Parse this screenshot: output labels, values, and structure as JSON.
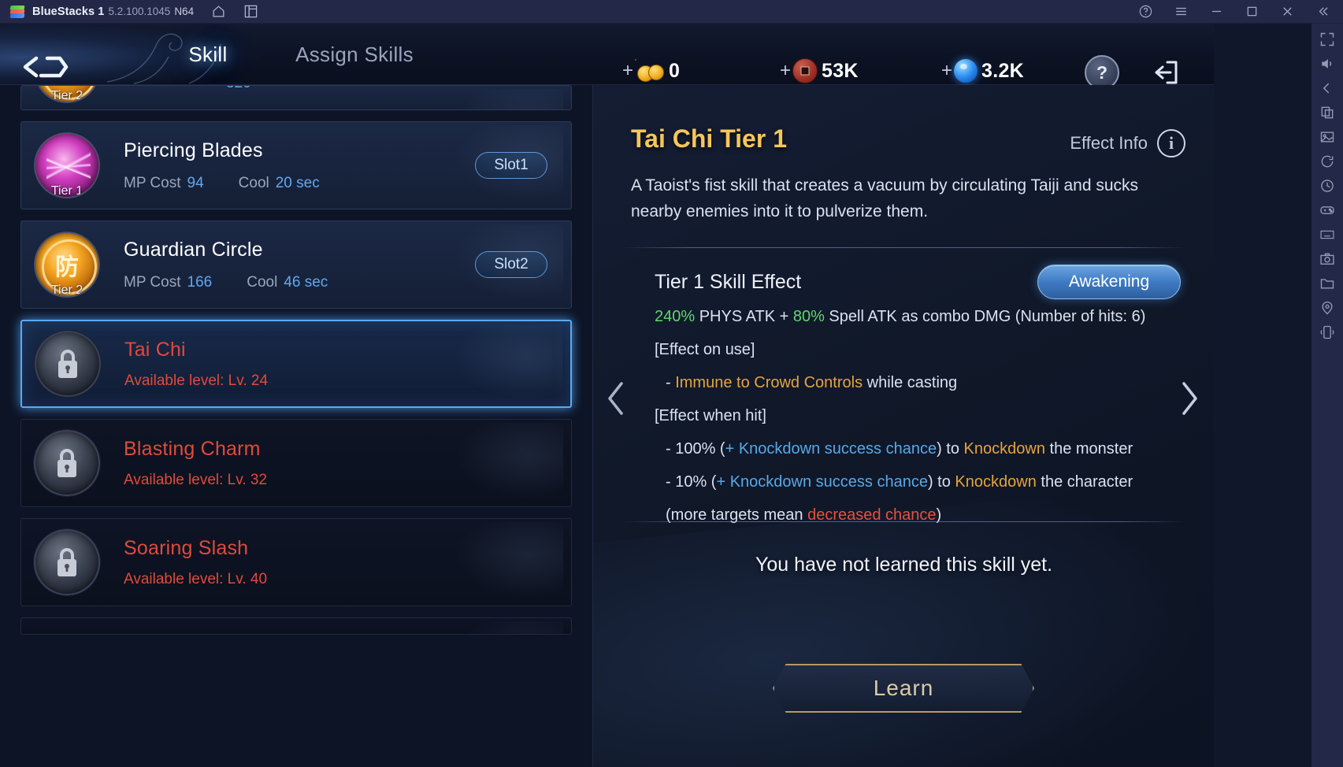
{
  "titlebar": {
    "app_name": "BlueStacks 1",
    "version": "5.2.100.1045",
    "arch": "N64",
    "icons": [
      "home-icon",
      "multi-instance-icon"
    ],
    "right_icons": [
      "help-icon",
      "menu-icon",
      "minimize-icon",
      "maximize-icon",
      "close-icon",
      "collapse-icon"
    ]
  },
  "rail": {
    "icons": [
      "fullscreen-icon",
      "volume-icon",
      "back-icon",
      "copy-icon",
      "gallery-icon",
      "rotate-icon",
      "clock-icon",
      "game-controls-icon",
      "keyboard-icon",
      "screenshot-icon",
      "folder-icon",
      "location-icon",
      "shake-icon"
    ]
  },
  "game_topbar": {
    "back_icon": "back-arrow-icon",
    "tabs": [
      {
        "label": "Skill",
        "active": true
      },
      {
        "label": "Assign Skills",
        "active": false
      }
    ],
    "currencies": [
      {
        "icon": "gold-coin-icon",
        "value": "0",
        "plus": "+"
      },
      {
        "icon": "copper-coin-icon",
        "value": "53K",
        "plus": "+"
      },
      {
        "icon": "blue-gem-icon",
        "value": "3.2K",
        "plus": "+"
      }
    ],
    "help_label": "?",
    "exit_icon": "exit-door-icon"
  },
  "skill_list": [
    {
      "partial": true,
      "name": "",
      "tier": "Tier 2",
      "state": "cut-off-top"
    },
    {
      "name": "Piercing Blades",
      "tier": "Tier 1",
      "mp_label": "MP Cost",
      "mp_value": "94",
      "cool_label": "Cool",
      "cool_value": "20 sec",
      "slot": "Slot1",
      "icon": "piercing-blades-icon",
      "locked": false,
      "selected": false
    },
    {
      "name": "Guardian Circle",
      "tier": "Tier 2",
      "mp_label": "MP Cost",
      "mp_value": "166",
      "cool_label": "Cool",
      "cool_value": "46 sec",
      "slot": "Slot2",
      "icon": "guardian-circle-icon",
      "cjk": "防",
      "locked": false,
      "selected": false
    },
    {
      "name": "Tai Chi",
      "lock_text": "Available level: Lv. 24",
      "icon": "padlock-icon",
      "locked": true,
      "selected": true
    },
    {
      "name": "Blasting Charm",
      "lock_text": "Available level: Lv. 32",
      "icon": "padlock-icon",
      "locked": true,
      "selected": false
    },
    {
      "name": "Soaring Slash",
      "lock_text": "Available level: Lv. 40",
      "icon": "padlock-icon",
      "locked": true,
      "selected": false
    }
  ],
  "detail": {
    "title": "Tai Chi Tier 1",
    "effect_info_label": "Effect Info",
    "info_icon": "info-icon",
    "description": "A Taoist's fist skill that creates a vacuum by circulating Taiji and sucks nearby enemies into it to pulverize them.",
    "effect_heading": "Tier 1 Skill Effect",
    "awakening_label": "Awakening",
    "effect_lines": [
      {
        "parts": [
          {
            "t": "240%",
            "c": "green"
          },
          {
            "t": " PHYS ATK + ",
            "c": "normal"
          },
          {
            "t": "80%",
            "c": "green"
          },
          {
            "t": " Spell ATK as combo DMG (Number of hits: 6)",
            "c": "normal"
          }
        ],
        "indent": false
      },
      {
        "parts": [
          {
            "t": "[Effect on use]",
            "c": "normal"
          }
        ],
        "indent": false
      },
      {
        "parts": [
          {
            "t": "- ",
            "c": "normal"
          },
          {
            "t": "Immune to Crowd Controls",
            "c": "orange"
          },
          {
            "t": " while casting",
            "c": "normal"
          }
        ],
        "indent": true
      },
      {
        "parts": [
          {
            "t": "[Effect when hit]",
            "c": "normal"
          }
        ],
        "indent": false
      },
      {
        "parts": [
          {
            "t": "- 100% (",
            "c": "normal"
          },
          {
            "t": "+ Knockdown success chance",
            "c": "blue"
          },
          {
            "t": ") to ",
            "c": "normal"
          },
          {
            "t": "Knockdown",
            "c": "orange"
          },
          {
            "t": " the monster",
            "c": "normal"
          }
        ],
        "indent": true
      },
      {
        "parts": [
          {
            "t": "- 10% (",
            "c": "normal"
          },
          {
            "t": "+ Knockdown success chance",
            "c": "blue"
          },
          {
            "t": ") to ",
            "c": "normal"
          },
          {
            "t": "Knockdown",
            "c": "orange"
          },
          {
            "t": " the character",
            "c": "normal"
          }
        ],
        "indent": true
      },
      {
        "parts": [
          {
            "t": "(more targets mean ",
            "c": "normal"
          },
          {
            "t": "decreased chance",
            "c": "red"
          },
          {
            "t": ")",
            "c": "normal"
          }
        ],
        "indent": true
      }
    ],
    "prev_icon": "chevron-left-icon",
    "next_icon": "chevron-right-icon",
    "status_message": "You have not learned this skill yet.",
    "learn_label": "Learn"
  },
  "colors": {
    "title_gold": "#f5c65a",
    "locked_red": "#e04a3c",
    "accent_blue": "#58a8e8",
    "effect_green": "#5fd96a",
    "effect_orange": "#e8a33c",
    "effect_red": "#e8503c"
  }
}
